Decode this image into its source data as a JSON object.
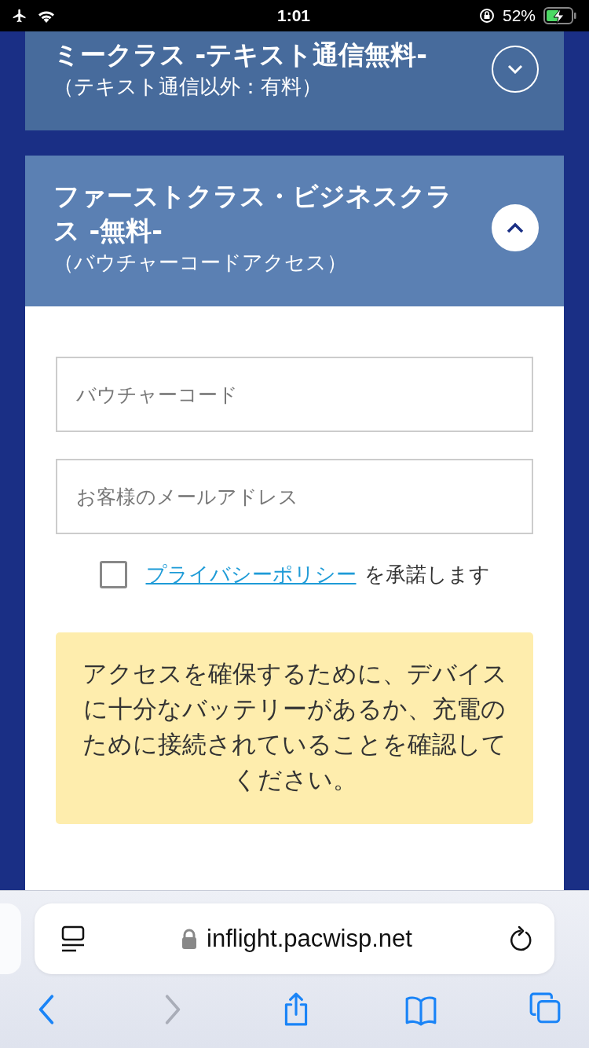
{
  "status_bar": {
    "time": "1:01",
    "battery": "52%",
    "charging": true
  },
  "sections": [
    {
      "title": "ミークラス -テキスト通信無料-",
      "subtitle": "（テキスト通信以外：有料）",
      "expanded": false
    },
    {
      "title": "ファーストクラス・ビジネスクラス -無料-",
      "subtitle": "（バウチャーコードアクセス）",
      "expanded": true
    }
  ],
  "form": {
    "fields": [
      {
        "placeholder": "バウチャーコード"
      },
      {
        "placeholder": "お客様のメールアドレス"
      }
    ],
    "consent": {
      "checked": false,
      "link": "プライバシーポリシー",
      "text": "を承諾します"
    },
    "notice": "アクセスを確保するために、デバイスに十分なバッテリーがあるか、充電のために接続されていることを確認してください。"
  },
  "browser": {
    "url": "inflight.pacwisp.net",
    "nav": [
      {
        "kind": "back",
        "disabled": false
      },
      {
        "kind": "forward",
        "disabled": true
      },
      {
        "kind": "share",
        "disabled": false
      },
      {
        "kind": "bookmarks",
        "disabled": false
      },
      {
        "kind": "tabs",
        "disabled": false
      }
    ]
  }
}
